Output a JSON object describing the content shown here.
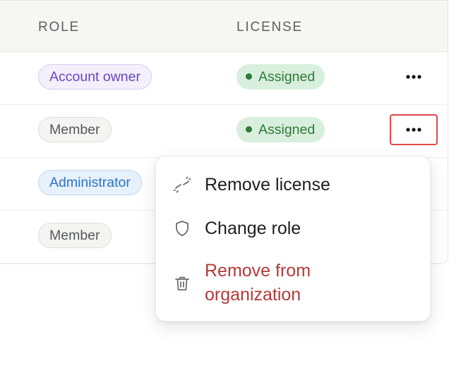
{
  "table": {
    "columns": {
      "role": "ROLE",
      "license": "LICENSE"
    },
    "rows": [
      {
        "role": "Account owner",
        "role_type": "owner",
        "license": "Assigned",
        "actions": "More actions"
      },
      {
        "role": "Member",
        "role_type": "member",
        "license": "Assigned",
        "actions": "More actions"
      },
      {
        "role": "Administrator",
        "role_type": "admin",
        "license": "",
        "actions": ""
      },
      {
        "role": "Member",
        "role_type": "member",
        "license": "",
        "actions": ""
      }
    ]
  },
  "menu": {
    "items": [
      {
        "label": "Remove license",
        "icon": "unlink-icon"
      },
      {
        "label": "Change role",
        "icon": "shield-icon"
      },
      {
        "label_line1": "Remove from",
        "label_line2": "organization",
        "icon": "trash-icon",
        "danger": true
      }
    ]
  },
  "colors": {
    "highlight_border": "#e0484a",
    "assigned_bg": "#d9efdd",
    "assigned_text": "#2d7a3a",
    "danger_text": "#b23a3a"
  }
}
